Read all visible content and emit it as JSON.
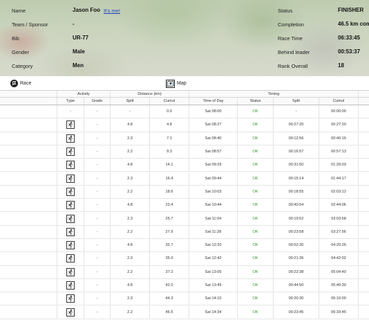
{
  "header": {
    "left": [
      {
        "label": "Name",
        "value": "Jason Foo"
      },
      {
        "label": "Team / Sponsor",
        "value": "-"
      },
      {
        "label": "Bib",
        "value": "UR-77"
      },
      {
        "label": "Gender",
        "value": "Male"
      },
      {
        "label": "Category",
        "value": "Men"
      }
    ],
    "its_me_link": "It's me!",
    "right": [
      {
        "label": "Status",
        "value": "FINISHER"
      },
      {
        "label": "Completion",
        "value": "46.5 km com"
      },
      {
        "label": "Race Time",
        "value": "06:33:45"
      },
      {
        "label": "Behind leader",
        "value": "00:53:37"
      },
      {
        "label": "Rank Overall",
        "value": "18"
      }
    ]
  },
  "toolbar": {
    "race_label": "Race",
    "map_label": "Map"
  },
  "table": {
    "group_headers": {
      "activity": "Activity",
      "distance": "Distance (km)",
      "timing": "Timing"
    },
    "columns": [
      "Type",
      "Grade",
      "Split",
      "Cumul",
      "Time of Day",
      "Status",
      "Split",
      "Cumul"
    ],
    "rows": [
      {
        "icon": false,
        "type": "-",
        "grade": "-",
        "dsplit": "-",
        "dcumul": "0.0",
        "tod": "Sat 08:00",
        "status": "OK",
        "tsplit": "-",
        "tcumul": "00:00:00"
      },
      {
        "icon": true,
        "type": "",
        "grade": "-",
        "dsplit": "4.8",
        "dcumul": "4.8",
        "tod": "Sat 08:27",
        "status": "OK",
        "tsplit": "00:27:20",
        "tcumul": "00:27:20"
      },
      {
        "icon": true,
        "type": "",
        "grade": "-",
        "dsplit": "2.3",
        "dcumul": "7.1",
        "tod": "Sat 08:40",
        "status": "OK",
        "tsplit": "00:12:56",
        "tcumul": "00:40:16"
      },
      {
        "icon": true,
        "type": "",
        "grade": "-",
        "dsplit": "2.2",
        "dcumul": "9.3",
        "tod": "Sat 08:57",
        "status": "OK",
        "tsplit": "00:16:57",
        "tcumul": "00:57:13"
      },
      {
        "icon": true,
        "type": "",
        "grade": "-",
        "dsplit": "4.8",
        "dcumul": "14.1",
        "tod": "Sat 09:29",
        "status": "OK",
        "tsplit": "00:31:50",
        "tcumul": "01:29:03"
      },
      {
        "icon": true,
        "type": "",
        "grade": "-",
        "dsplit": "2.3",
        "dcumul": "16.4",
        "tod": "Sat 09:44",
        "status": "OK",
        "tsplit": "00:15:14",
        "tcumul": "01:44:17"
      },
      {
        "icon": true,
        "type": "",
        "grade": "-",
        "dsplit": "2.2",
        "dcumul": "18.6",
        "tod": "Sat 10:03",
        "status": "OK",
        "tsplit": "00:18:55",
        "tcumul": "02:03:12"
      },
      {
        "icon": true,
        "type": "",
        "grade": "-",
        "dsplit": "4.8",
        "dcumul": "23.4",
        "tod": "Sat 10:44",
        "status": "OK",
        "tsplit": "00:40:54",
        "tcumul": "02:44:06"
      },
      {
        "icon": true,
        "type": "",
        "grade": "-",
        "dsplit": "2.3",
        "dcumul": "25.7",
        "tod": "Sat 11:04",
        "status": "OK",
        "tsplit": "00:19:52",
        "tcumul": "03:03:58"
      },
      {
        "icon": true,
        "type": "",
        "grade": "-",
        "dsplit": "2.2",
        "dcumul": "27.9",
        "tod": "Sat 11:28",
        "status": "OK",
        "tsplit": "00:23:58",
        "tcumul": "03:27:56"
      },
      {
        "icon": true,
        "type": "",
        "grade": "-",
        "dsplit": "4.8",
        "dcumul": "32.7",
        "tod": "Sat 12:20",
        "status": "OK",
        "tsplit": "00:52:30",
        "tcumul": "04:20:26"
      },
      {
        "icon": true,
        "type": "",
        "grade": "-",
        "dsplit": "2.3",
        "dcumul": "35.0",
        "tod": "Sat 12:42",
        "status": "OK",
        "tsplit": "00:21:36",
        "tcumul": "04:42:02"
      },
      {
        "icon": true,
        "type": "",
        "grade": "-",
        "dsplit": "2.2",
        "dcumul": "37.2",
        "tod": "Sat 13:05",
        "status": "OK",
        "tsplit": "00:22:38",
        "tcumul": "05:04:40"
      },
      {
        "icon": true,
        "type": "",
        "grade": "-",
        "dsplit": "4.8",
        "dcumul": "42.0",
        "tod": "Sat 13:49",
        "status": "OK",
        "tsplit": "00:44:50",
        "tcumul": "05:49:30"
      },
      {
        "icon": true,
        "type": "",
        "grade": "-",
        "dsplit": "2.3",
        "dcumul": "44.3",
        "tod": "Sat 14:10",
        "status": "OK",
        "tsplit": "00:20:30",
        "tcumul": "06:10:00"
      },
      {
        "icon": true,
        "type": "",
        "grade": "-",
        "dsplit": "2.2",
        "dcumul": "46.5",
        "tod": "Sat 14:34",
        "status": "OK",
        "tsplit": "00:23:45",
        "tcumul": "06:33:45"
      }
    ]
  },
  "colors": {
    "ok": "#2f9a2f",
    "link": "#1a3fbf"
  }
}
